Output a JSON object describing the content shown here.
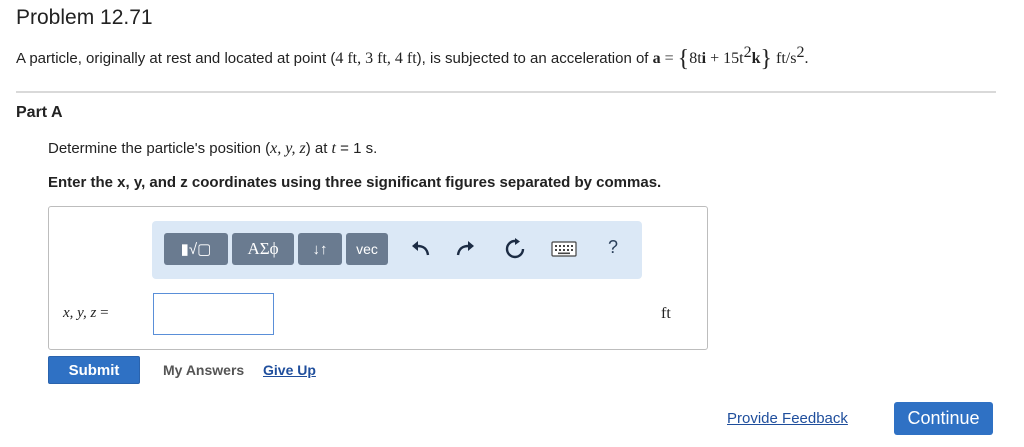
{
  "header": {
    "title": "Problem 12.71"
  },
  "problem": {
    "text_before": "A particle, originally at rest and located at point (",
    "point": "4 ft, 3 ft, 4 ft",
    "text_mid": "), is subjected to an acceleration of ",
    "accel_symbol": "a",
    "equals": " = ",
    "brace_open": "{",
    "term1": "8t",
    "term1_vec": "i",
    "plus": " + ",
    "term2": "15t",
    "term2_exp": "2",
    "term2_vec": "k",
    "brace_close": "}",
    "unit": " ft/s",
    "unit_exp": "2",
    "end": "."
  },
  "part": {
    "label": "Part A",
    "prompt_before": "Determine the particle's position (",
    "prompt_vars": "x, y, z",
    "prompt_mid": ") at ",
    "prompt_t": "t",
    "prompt_after": " = 1 s.",
    "instruction": "Enter the x, y, and z coordinates using three significant figures separated by commas."
  },
  "toolbar": {
    "templates_label": "▮√▢",
    "greek_label": "ΑΣϕ",
    "updown_label": "↓↑",
    "vec_label": "vec",
    "help_label": "?",
    "icons": [
      "undo-icon",
      "redo-icon",
      "reset-icon",
      "keyboard-icon"
    ]
  },
  "answer": {
    "label": "x, y, z",
    "label_eq": " =",
    "value": "",
    "unit": "ft"
  },
  "actions": {
    "submit": "Submit",
    "my_answers": "My Answers",
    "give_up": "Give Up",
    "feedback": "Provide Feedback",
    "continue": "Continue"
  },
  "colors": {
    "primary": "#2f71c4",
    "toolbar_bg": "#dbe8f6",
    "toolbar_btn": "#6a7b90",
    "link": "#1f4e9c"
  }
}
